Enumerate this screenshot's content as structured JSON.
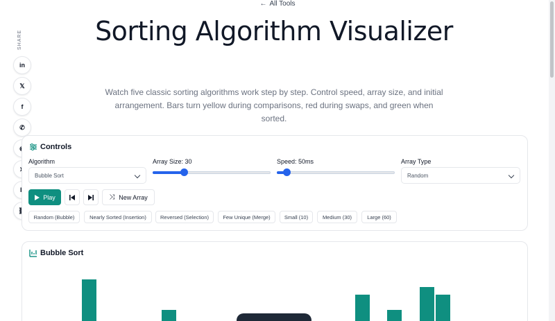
{
  "nav": {
    "back_label": "All Tools"
  },
  "header": {
    "title": "Sorting Algorithm Visualizer",
    "subtitle": "Watch five classic sorting algorithms work step by step. Control speed, array size, and initial arrangement. Bars turn yellow during comparisons, red during swaps, and green when sorted."
  },
  "share": {
    "label": "SHARE",
    "buttons": [
      {
        "icon": "linkedin-icon",
        "glyph": "in"
      },
      {
        "icon": "x-icon",
        "glyph": "𝕏"
      },
      {
        "icon": "facebook-icon",
        "glyph": "f"
      },
      {
        "icon": "whatsapp-icon",
        "glyph": "✆"
      },
      {
        "icon": "reddit-icon",
        "glyph": "◉"
      },
      {
        "icon": "telegram-icon",
        "glyph": "➤"
      },
      {
        "icon": "pinterest-icon",
        "glyph": "P"
      },
      {
        "icon": "link-icon",
        "glyph": "⛓"
      }
    ]
  },
  "controls": {
    "title": "Controls",
    "algorithm": {
      "label": "Algorithm",
      "value": "Bubble Sort"
    },
    "array_size": {
      "label": "Array Size: 30",
      "value": 30,
      "min": 5,
      "max": 100
    },
    "speed": {
      "label": "Speed: 50ms",
      "value": 50,
      "min": 10,
      "max": 500
    },
    "array_type": {
      "label": "Array Type",
      "value": "Random"
    },
    "play_label": "Play",
    "new_array_label": "New Array",
    "presets": [
      "Random (Bubble)",
      "Nearly Sorted (Insertion)",
      "Reversed (Selection)",
      "Few Unique (Merge)",
      "Small (10)",
      "Medium (30)",
      "Large (60)"
    ]
  },
  "visualization": {
    "title": "Bubble Sort"
  },
  "colors": {
    "accent": "#0f8f80",
    "slider": "#2563eb",
    "text": "#111827",
    "muted": "#6b7280",
    "border": "#e5e7eb"
  }
}
